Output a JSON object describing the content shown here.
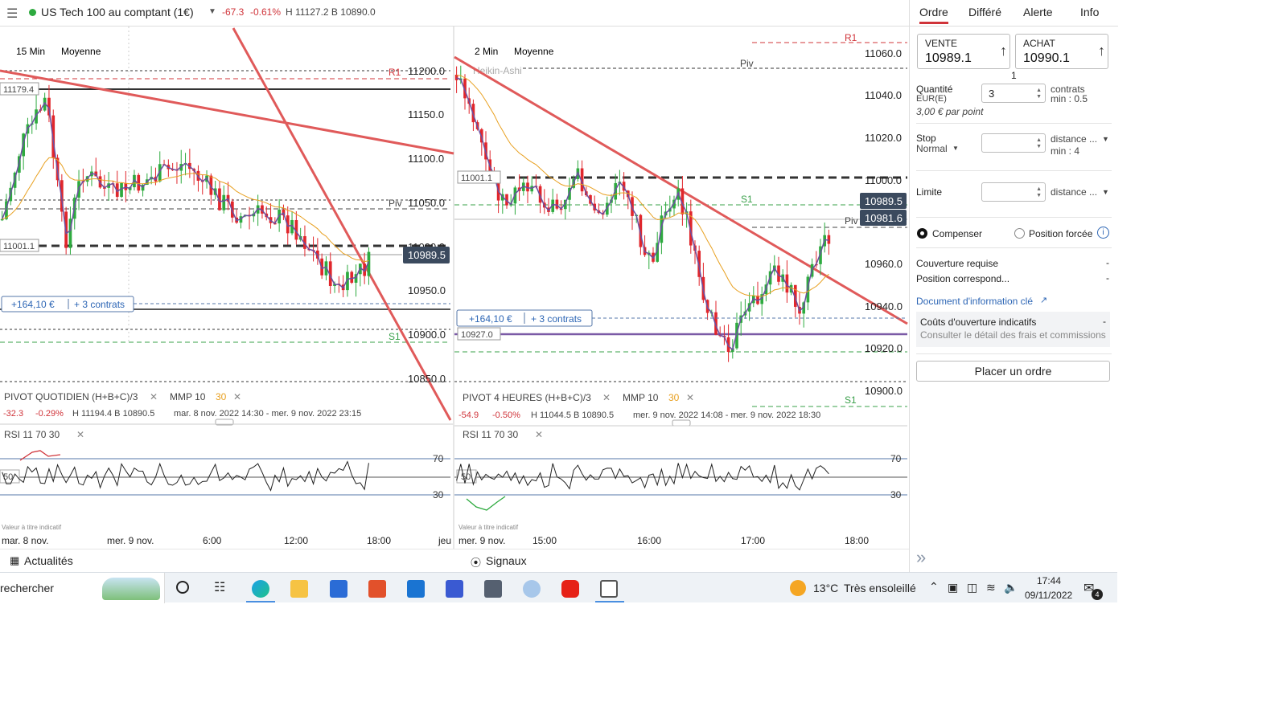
{
  "topbar": {
    "menu_icon": "hamburger-menu-icon",
    "instrument": "US Tech 100 au comptant (1€)",
    "change": "-67.3",
    "change_pct": "-0.61%",
    "high_low": "H 11127.2 B 10890.0"
  },
  "left_chart": {
    "timeframe": "15 Min",
    "avg_label": "Moyenne",
    "price_labels": [
      "11200.0",
      "11150.0",
      "11100.0",
      "11050.0",
      "11000.0",
      "10950.0",
      "10900.0",
      "10850.0"
    ],
    "tag_top": "11179.4",
    "tag_mid": "11001.1",
    "current_price": "10989.5",
    "position_value": "+164,10 €",
    "position_contracts": "+ 3 contrats",
    "pivot_labels": {
      "r1": "R1",
      "piv": "Piv",
      "s1": "S1"
    },
    "indicator_line": "PIVOT  QUOTIDIEN  (H+B+C)/3",
    "mmp": "MMP  10",
    "mmp_b": "30",
    "stat_change": "-32.3",
    "stat_pct": "-0.29%",
    "stat_hb": "H 11194.4   B 10890.5",
    "stat_period": "mar. 8 nov. 2022 14:30 - mer. 9 nov. 2022 23:15",
    "rsi_label": "RSI  11  70  30",
    "rsi_levels": [
      "70",
      "30"
    ],
    "rsi_mid": "50",
    "note": "Valeur à titre indicatif",
    "x_labels": [
      "mar. 8 nov.",
      "mer. 9 nov.",
      "6:00",
      "12:00",
      "18:00",
      "jeu"
    ]
  },
  "right_chart": {
    "timeframe": "2 Min",
    "avg_label": "Moyenne",
    "style": "Heikin-Ashi",
    "price_labels": [
      "11060.0",
      "11040.0",
      "11020.0",
      "11000.0",
      "10960.0",
      "10940.0",
      "10920.0",
      "10900.0"
    ],
    "tag_mid": "11001.1",
    "tag_low": "10927.0",
    "current_sell": "10989.5",
    "current_other": "10981.6",
    "position_value": "+164,10 €",
    "position_contracts": "+ 3 contrats",
    "pivot_labels": {
      "r1": "R1",
      "piv": "Piv",
      "s1": "S1"
    },
    "indicator_line": "PIVOT  4 HEURES  (H+B+C)/3",
    "mmp": "MMP  10",
    "mmp_b": "30",
    "stat_change": "-54.9",
    "stat_pct": "-0.50%",
    "stat_hb": "H 11044.5   B 10890.5",
    "stat_period": "mer. 9 nov. 2022 14:08 - mer. 9 nov. 2022 18:30",
    "rsi_label": "RSI  11  70  30",
    "rsi_levels": [
      "70",
      "30"
    ],
    "rsi_mid": "50",
    "note": "Valeur à titre indicatif",
    "x_labels": [
      "mer. 9 nov.",
      "15:00",
      "16:00",
      "17:00",
      "18:00"
    ]
  },
  "bottom_tabs": {
    "news": "Actualités",
    "signals": "Signaux"
  },
  "order_panel": {
    "tabs": [
      "Ordre",
      "Différé",
      "Alerte",
      "Info"
    ],
    "sell_label": "VENTE",
    "sell_value": "10989.1",
    "buy_label": "ACHAT",
    "buy_value": "10990.1",
    "spread": "1",
    "quantity_label": "Quantité",
    "quantity_currency": "EUR(E)",
    "quantity_value": "3",
    "contracts_label": "contrats",
    "contracts_min": "min : 0.5",
    "per_point": "3,00 € par point",
    "stop_label": "Stop",
    "stop_type": "Normal",
    "stop_distance": "distance ...",
    "stop_min": "min : 4",
    "limit_label": "Limite",
    "limit_distance": "distance ...",
    "radio_compensate": "Compenser",
    "radio_forced": "Position forcée",
    "margin_label": "Couverture requise",
    "margin_value": "-",
    "position_label": "Position correspond...",
    "position_value": "-",
    "doc_link": "Document d'information clé",
    "costs_title": "Coûts d'ouverture indicatifs",
    "costs_value": "-",
    "costs_detail": "Consulter le détail des frais et commissions",
    "place_order": "Placer un ordre",
    "collapse_icon": "double-chevron-right-icon"
  },
  "taskbar": {
    "search_text": "rechercher",
    "weather_temp": "13°C",
    "weather_desc": "Très ensoleillé",
    "time": "17:44",
    "date": "09/11/2022",
    "notif_count": "4"
  },
  "colors": {
    "accent_red": "#d0343a",
    "up_green": "#2eaa3f",
    "link_blue": "#2d66b5"
  }
}
